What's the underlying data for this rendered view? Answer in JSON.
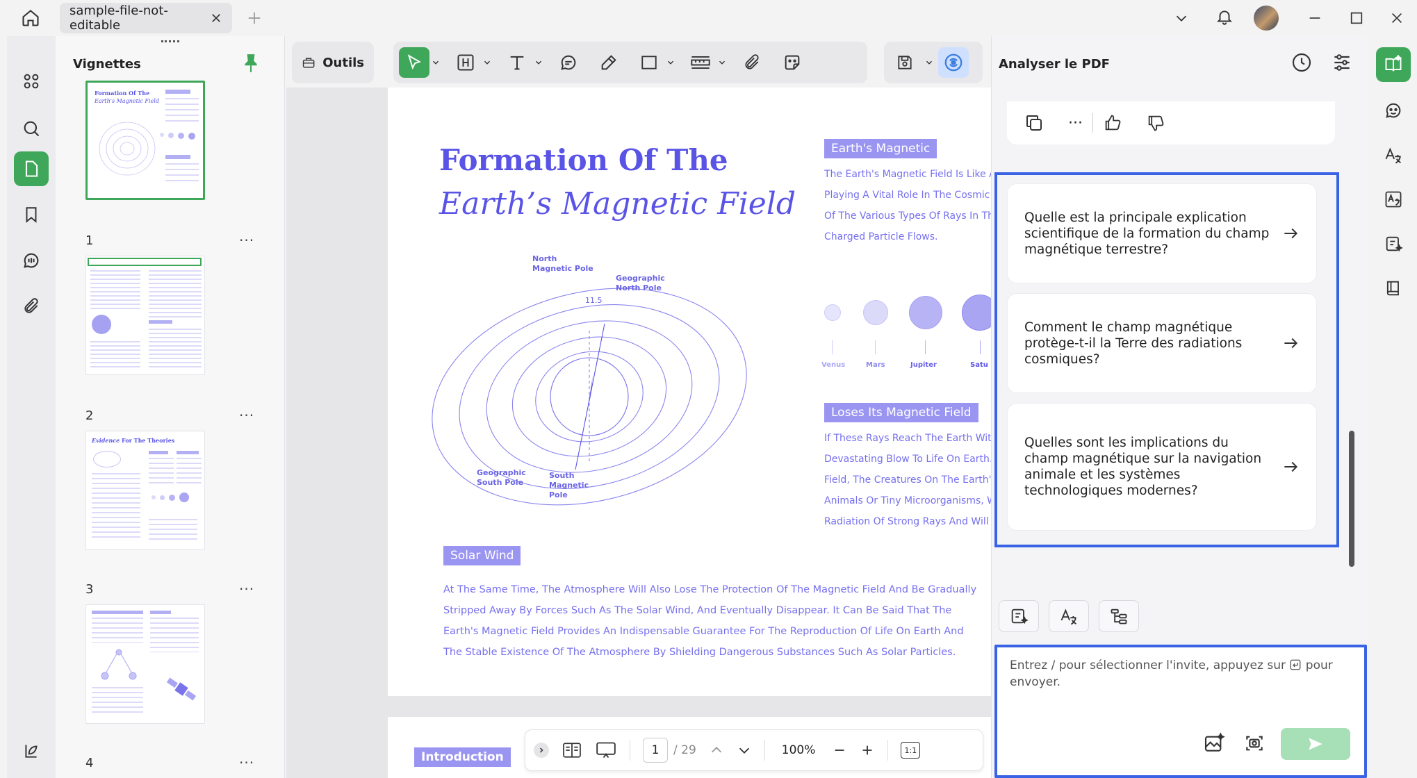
{
  "titlebar": {
    "tab_title": "sample-file-not-editable"
  },
  "thumbnails": {
    "title": "Vignettes",
    "pages": [
      {
        "number": "1"
      },
      {
        "number": "2"
      },
      {
        "number": "3"
      },
      {
        "number": "4"
      }
    ],
    "more_label": "···",
    "thumb3_title_italic": "Evidence",
    "thumb3_title": " For The Theories",
    "thumb1_title1": "Formation Of The",
    "thumb1_title2": "Earth's Magnetic Field"
  },
  "toolbar": {
    "outils_label": "Outils"
  },
  "document": {
    "title_line1": "Formation Of The",
    "title_line2": "Earth’s Magnetic Field",
    "chip_earth": "Earth's Magnetic",
    "earth_lines": [
      "The Earth's Magnetic Field Is Like A",
      "Playing A Vital Role In The Cosmic E",
      "Of The Various Types Of Rays In The",
      "Charged Particle Flows."
    ],
    "planets": [
      "Venus",
      "Mars",
      "Jupiter",
      "Satu"
    ],
    "chip_loses": "Loses Its Magnetic Field",
    "loses_lines": [
      "If These Rays Reach The Earth With",
      "Devastating Blow To Life On Earth. (",
      "Field, The Creatures On The Earth's",
      "Animals Or Tiny Microorganisms, Wi",
      "Radiation Of Strong Rays And Will Q"
    ],
    "chip_solar": "Solar Wind",
    "solar_lines": [
      "At The Same Time, The Atmosphere Will Also Lose The Protection Of The Magnetic Field And Be Gradually",
      "Stripped Away By Forces Such As The Solar Wind, And Eventually Disappear. It Can Be Said That The",
      "Earth's Magnetic Field Provides An Indispensable Guarantee For The Reproduction Of Life On Earth And",
      "The Stable Existence Of The Atmosphere By Shielding Dangerous Substances Such As Solar Particles."
    ],
    "figure": {
      "north_magnetic": [
        "North",
        "Magnetic Pole"
      ],
      "geographic_north": [
        "Geographic",
        "North Pole"
      ],
      "geographic_south": [
        "Geographic",
        "South Pole"
      ],
      "south_magnetic": [
        "South",
        "Magnetic",
        "Pole"
      ],
      "angle": "11.5"
    },
    "page2_chip": "Introduction"
  },
  "navbar": {
    "current_page": "1",
    "total_pages": "/ 29",
    "zoom": "100%",
    "fit_label": "1:1"
  },
  "ai_panel": {
    "title": "Analyser le PDF",
    "questions": [
      "Quelle est la principale explication scientifique de la formation du champ magnétique terrestre?",
      "Comment le champ magnétique protège-t-il la Terre des radiations cosmiques?",
      "Quelles sont les implications du champ magnétique sur la navigation animale et les systèmes technologiques modernes?"
    ],
    "input_placeholder_before": "Entrez / pour sélectionner l'invite, appuyez sur",
    "input_placeholder_after": "pour envoyer.",
    "more_label": "···"
  },
  "colors": {
    "accent_green": "#3fa75a",
    "doc_purple": "#5a54e6",
    "highlight_blue": "#3a62e4",
    "chip_purple": "#9b95f2"
  }
}
